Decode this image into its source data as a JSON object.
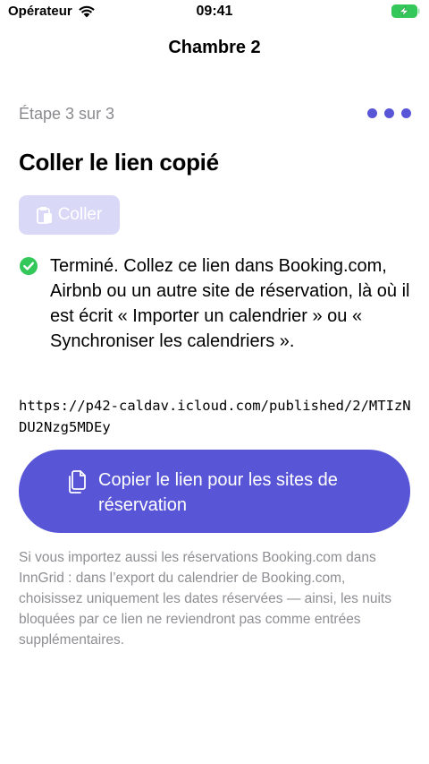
{
  "status_bar": {
    "carrier": "Opérateur",
    "time": "09:41",
    "battery_color": "#34c759"
  },
  "nav": {
    "title": "Chambre 2"
  },
  "step": {
    "label": "Étape 3 sur 3",
    "total": 3,
    "dot_color": "#5856d6"
  },
  "heading": "Coller le lien copié",
  "paste_button": {
    "label": "Coller",
    "icon": "clipboard-icon"
  },
  "done": {
    "icon": "checkmark-circle-icon",
    "icon_color": "#34c759",
    "text": "Terminé. Collez ce lien dans Booking.com, Airbnb ou un autre site de réservation, là où il est écrit « Importer un calendrier » ou « Synchroniser les calendriers »."
  },
  "link": "https://p42-caldav.icloud.com/published/2/MTIzNDU2Nzg5MDEy",
  "copy_button": {
    "label": "Copier le lien pour les sites de réservation",
    "icon": "copy-document-icon",
    "color": "#5856d6"
  },
  "footnote": "Si vous importez aussi les réservations Booking.com dans InnGrid : dans l’export du calendrier de Booking.com, choisissez uniquement les dates réservées — ainsi, les nuits bloquées par ce lien ne reviendront pas comme entrées supplémentaires."
}
